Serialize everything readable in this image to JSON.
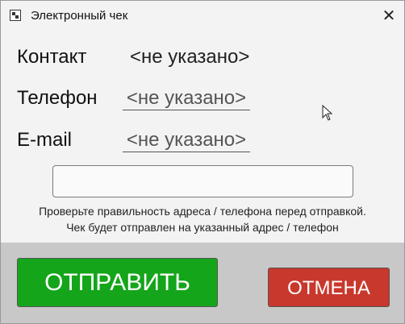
{
  "window": {
    "title": "Электронный чек",
    "close_symbol": "✕",
    "icon": "receipt-qr-icon"
  },
  "contact": {
    "label": "Контакт",
    "value": "<не указано>"
  },
  "phone": {
    "label": "Телефон",
    "value": "<не указано>"
  },
  "email": {
    "label": "E-mail",
    "value": "<не указано>"
  },
  "input": {
    "value": ""
  },
  "notes": {
    "line1": "Проверьте правильность адреса / телефона перед отправкой.",
    "line2": "Чек будет отправлен на указанный адрес / телефон"
  },
  "buttons": {
    "send": "ОТПРАВИТЬ",
    "cancel": "ОТМЕНА"
  },
  "colors": {
    "send": "#14a51a",
    "cancel": "#c8382c",
    "footer": "#c8c8c8",
    "background": "#f3f3f3"
  }
}
